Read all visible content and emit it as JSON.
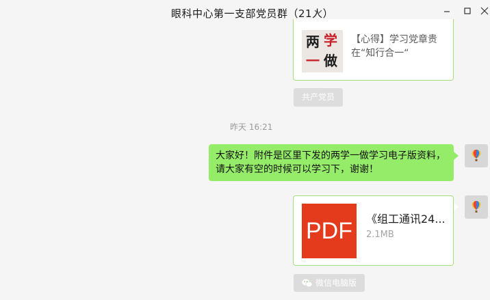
{
  "window": {
    "title": "眼科中心第一支部党员群（21人）"
  },
  "messages": {
    "link_card": {
      "thumb_chars": [
        "两",
        "学",
        "一",
        "做"
      ],
      "title_line1": "【心得】学习党章贵",
      "title_line2": "在“知行合一“",
      "source": "共产党员"
    },
    "timestamp": "昨天 16:21",
    "text_message": {
      "line1": "大家好！附件是区里下发的两学一做学习电子版资料，",
      "line2": "请大家有空的时候可以学习下，谢谢！",
      "color": "#95ec69"
    },
    "file_message": {
      "icon_label": "PDF",
      "name": "《组工通讯24...",
      "size": "2.1MB",
      "app_source": "微信电脑版",
      "icon_color": "#e43b1c"
    }
  },
  "colors": {
    "background": "#f5f5f5",
    "bubble_green": "#95ec69",
    "card_border": "#a6dd7b"
  },
  "icons": {
    "title_chevron": "chevron-down-icon",
    "minimize": "minimize-icon",
    "maximize": "maximize-icon",
    "close": "close-icon",
    "avatar": "balloon-avatar",
    "app_source": "wechat-icon"
  }
}
